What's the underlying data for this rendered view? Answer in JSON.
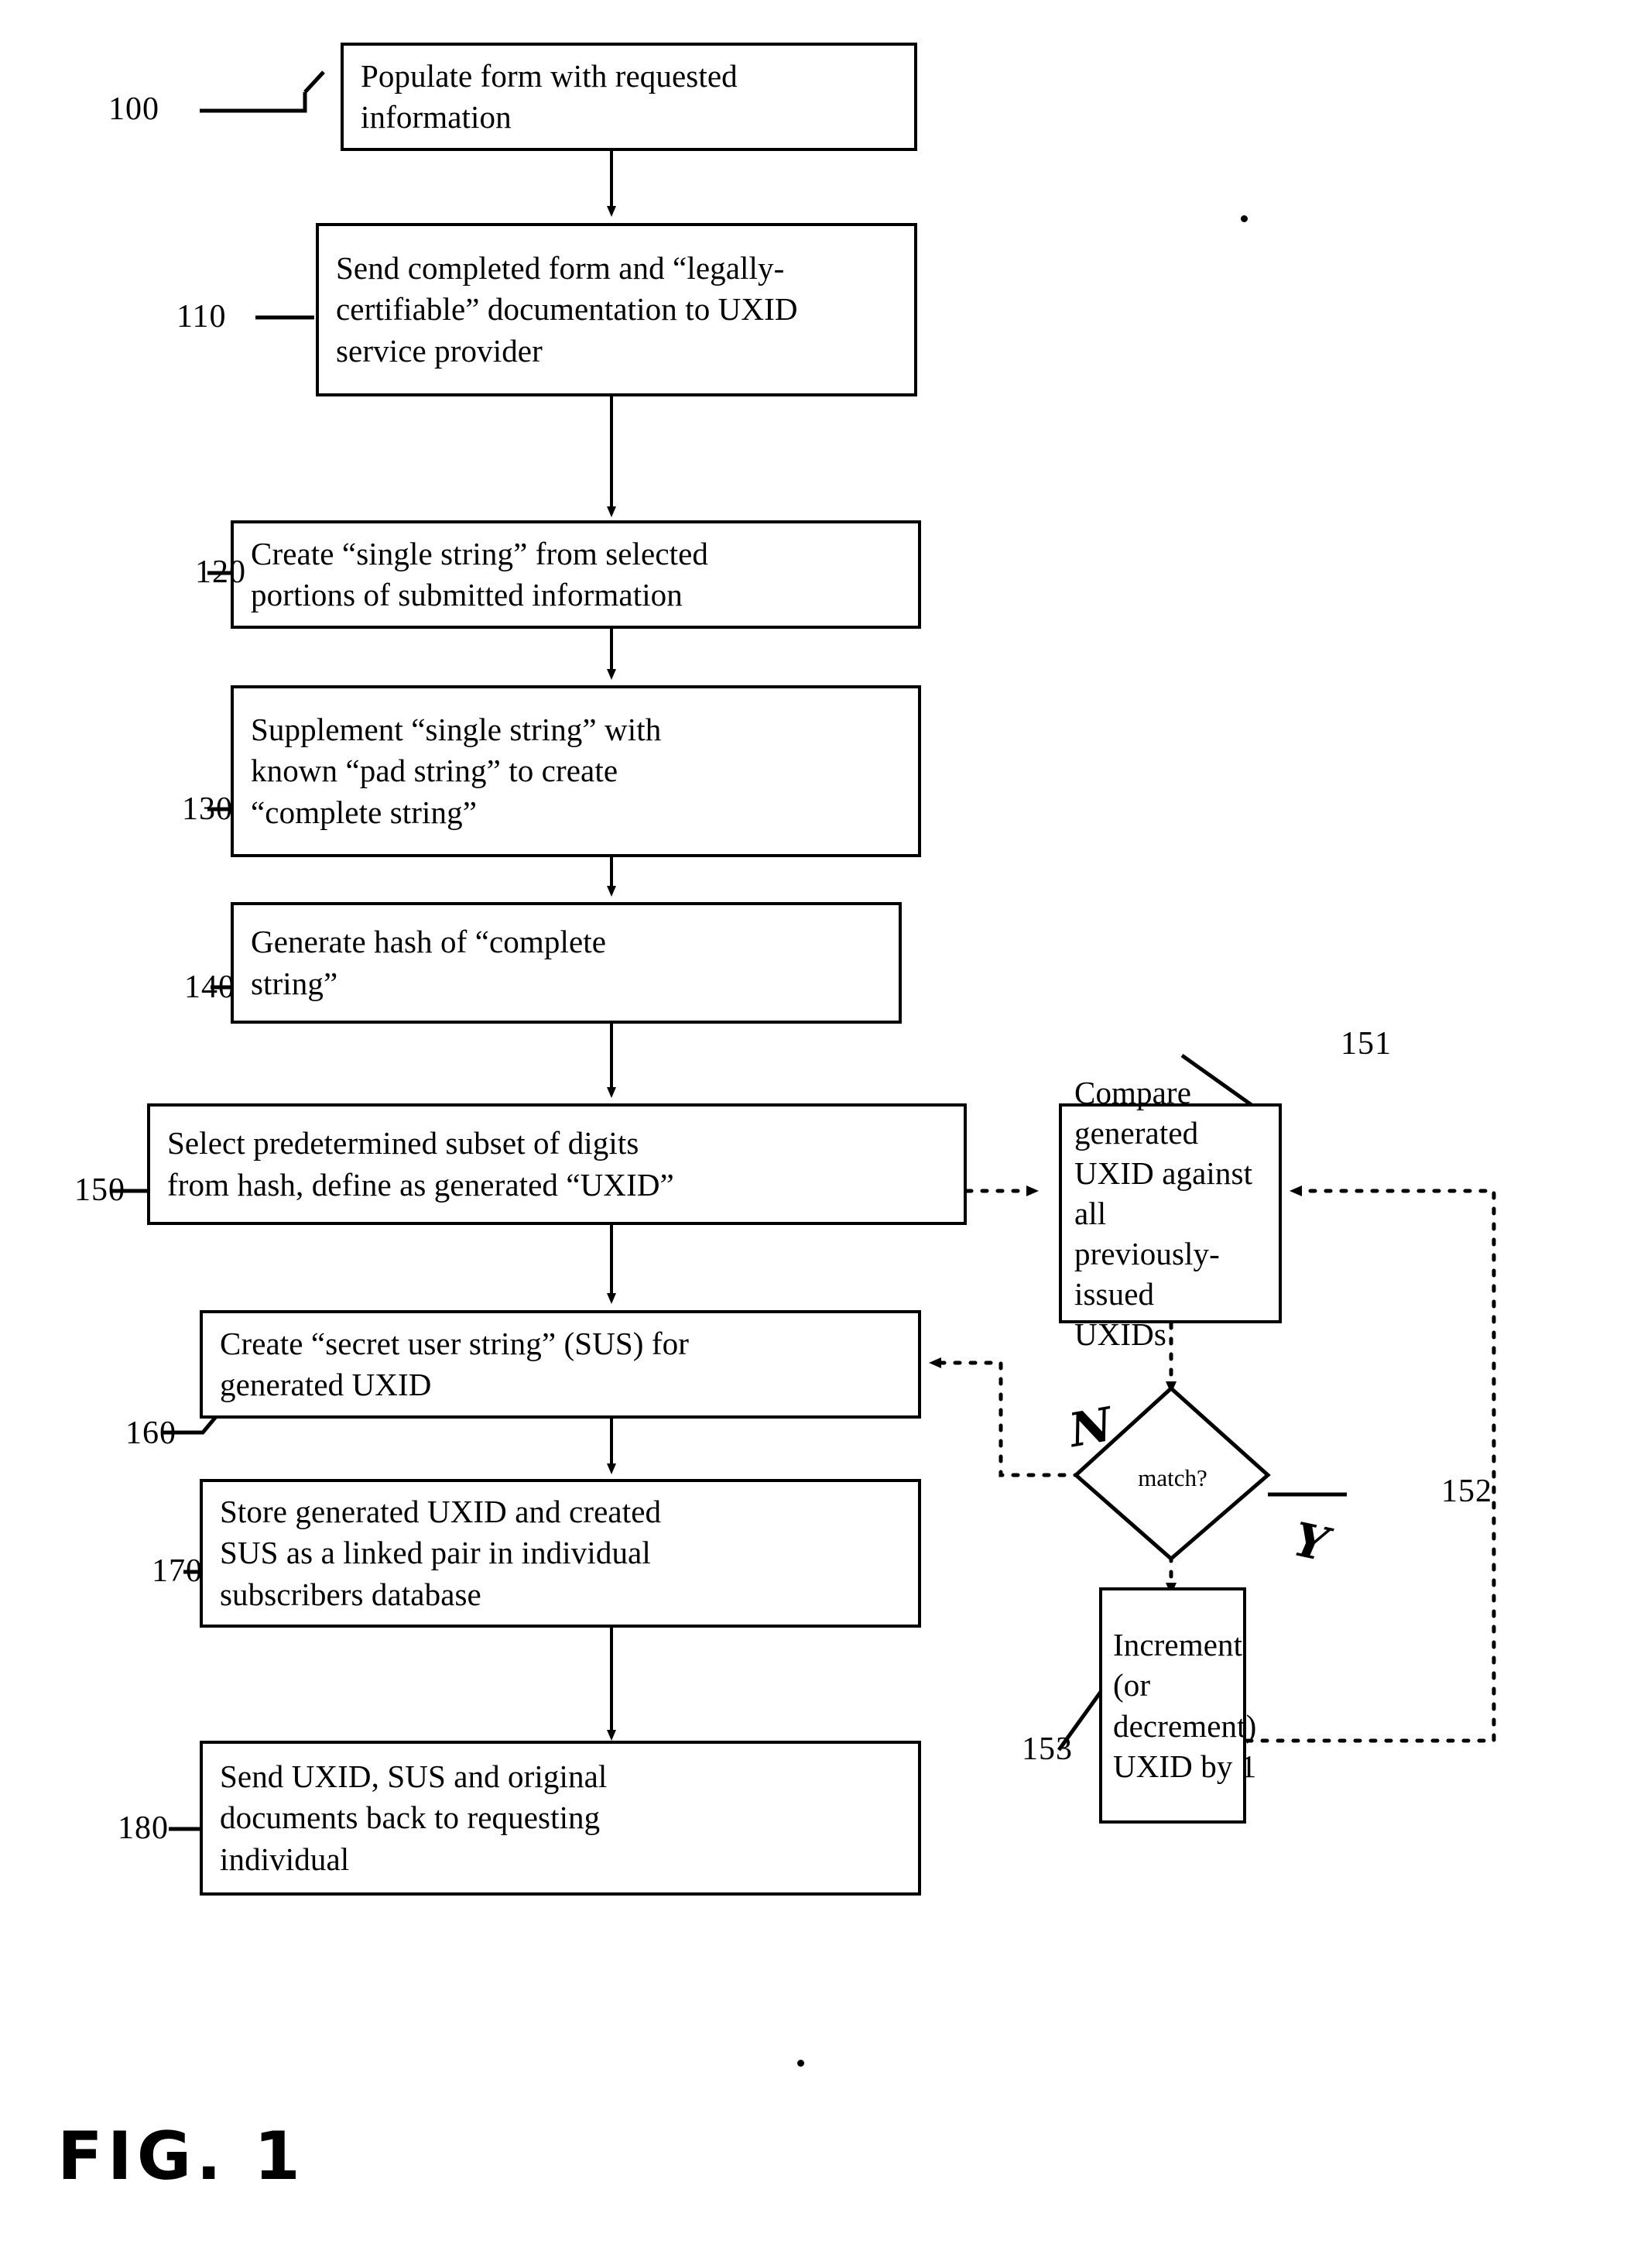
{
  "figure": {
    "caption": "FIG. 1",
    "title": "UXID generation process flowchart"
  },
  "nodes": [
    {
      "ref": "100",
      "name": "populate-form",
      "text": "Populate form with requested\ninformation",
      "shape": "process"
    },
    {
      "ref": "110",
      "name": "send-completed-form",
      "text": "Send completed form and “legally-\ncertifiable” documentation to UXID\nservice provider",
      "shape": "process"
    },
    {
      "ref": "120",
      "name": "create-single-string",
      "text": "Create “single string” from selected\nportions of submitted information",
      "shape": "process"
    },
    {
      "ref": "130",
      "name": "supplement-with-pad-string",
      "text": "Supplement “single string” with\nknown “pad string” to create\n“complete string”",
      "shape": "process"
    },
    {
      "ref": "140",
      "name": "generate-hash",
      "text": "Generate hash of “complete\nstring”",
      "shape": "process"
    },
    {
      "ref": "150",
      "name": "select-subset-of-digits",
      "text": "Select predetermined subset of digits\nfrom hash, define as generated “UXID”",
      "shape": "process"
    },
    {
      "ref": "160",
      "name": "create-secret-user-string",
      "text": "Create “secret user string” (SUS) for\ngenerated UXID",
      "shape": "process"
    },
    {
      "ref": "170",
      "name": "store-uxid-and-sus",
      "text": "Store generated UXID and created\nSUS as a linked pair in individual\nsubscribers database",
      "shape": "process"
    },
    {
      "ref": "180",
      "name": "send-uxid-sus-documents",
      "text": "Send UXID, SUS and original\ndocuments back to requesting\nindividual",
      "shape": "process"
    },
    {
      "ref": "151",
      "name": "compare-generated-uxid",
      "text": "Compare generated\nUXID against all\npreviously-issued\nUXIDs",
      "shape": "process"
    },
    {
      "ref": "152",
      "name": "match-decision",
      "text": "match?",
      "shape": "decision"
    },
    {
      "ref": "153",
      "name": "increment-uxid",
      "text": "Increment\n(or\ndecrement)\nUXID by 1",
      "shape": "process"
    }
  ],
  "branch_labels": [
    {
      "name": "branch-no",
      "text": "N"
    },
    {
      "name": "branch-yes",
      "text": "Y"
    }
  ],
  "colors": {
    "stroke": "#000000",
    "fill": "#ffffff"
  }
}
